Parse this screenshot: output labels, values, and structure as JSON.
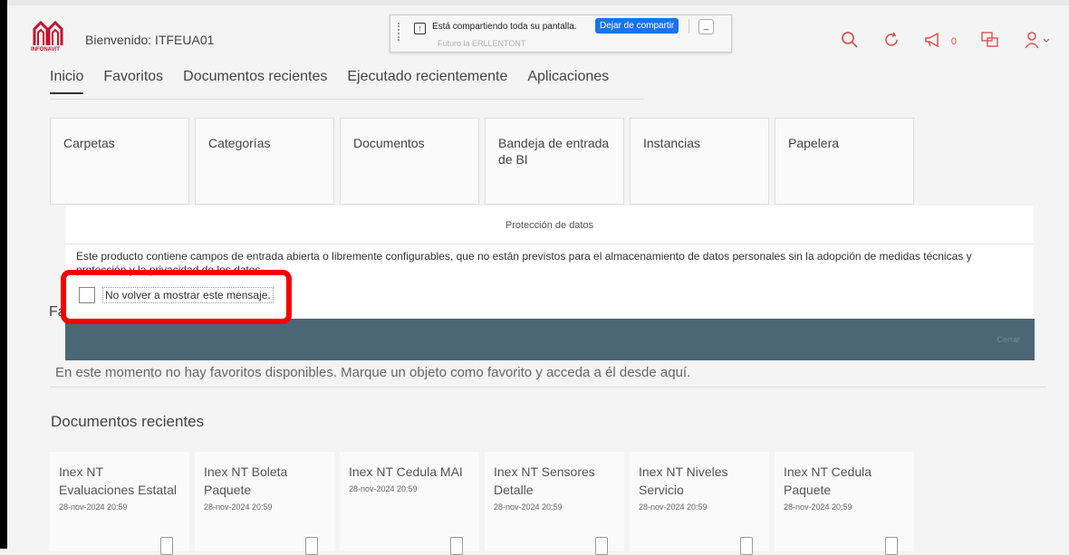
{
  "header": {
    "welcome": "Bienvenido: ITFEUA01",
    "logo_text": "INFONAVIT",
    "notification_count": "0"
  },
  "screen_share": {
    "message": "Está compartiendo toda su pantalla.",
    "stop_button": "Dejar de compartir",
    "hide_button": "_",
    "ghost_text": "Futuro    la     ERLLENTONT"
  },
  "tabs": [
    "Inicio",
    "Favoritos",
    "Documentos recientes",
    "Ejecutado recientemente",
    "Aplicaciones"
  ],
  "tiles": [
    "Carpetas",
    "Categorías",
    "Documentos",
    "Bandeja de entrada de BI",
    "Instancias",
    "Papelera"
  ],
  "modal": {
    "title": "Protección de datos",
    "body": "Este producto contiene campos de entrada abierta o libremente configurables, que no están previstos para el almacenamiento de datos personales sin la adopción de medidas técnicas y                                                              protección y la privacidad de los datos.",
    "checkbox_label": "No volver a mostrar este mensaje.",
    "footer_button": "Cerrar"
  },
  "favorites": {
    "partial_title": "Fa",
    "empty_message": "En este momento no hay favoritos disponibles. Marque un objeto como favorito y acceda a él desde aquí."
  },
  "recent": {
    "title": "Documentos recientes",
    "docs": [
      {
        "title": "Inex NT Evaluaciones Estatal",
        "date": "28-nov-2024 20:59"
      },
      {
        "title": "Inex NT Boleta Paquete",
        "date": "28-nov-2024 20:59"
      },
      {
        "title": "Inex NT Cedula MAI",
        "date": "28-nov-2024 20:59"
      },
      {
        "title": "Inex NT Sensores Detalle",
        "date": "28-nov-2024 20:59"
      },
      {
        "title": "Inex NT Niveles Servicio",
        "date": "28-nov-2024 20:59"
      },
      {
        "title": "Inex NT Cedula Paquete",
        "date": "28-nov-2024 20:59"
      }
    ]
  },
  "colors": {
    "accent": "#d9534f",
    "highlight": "#f50000",
    "share_button": "#1a73e8",
    "overlay": "#4b6675"
  }
}
